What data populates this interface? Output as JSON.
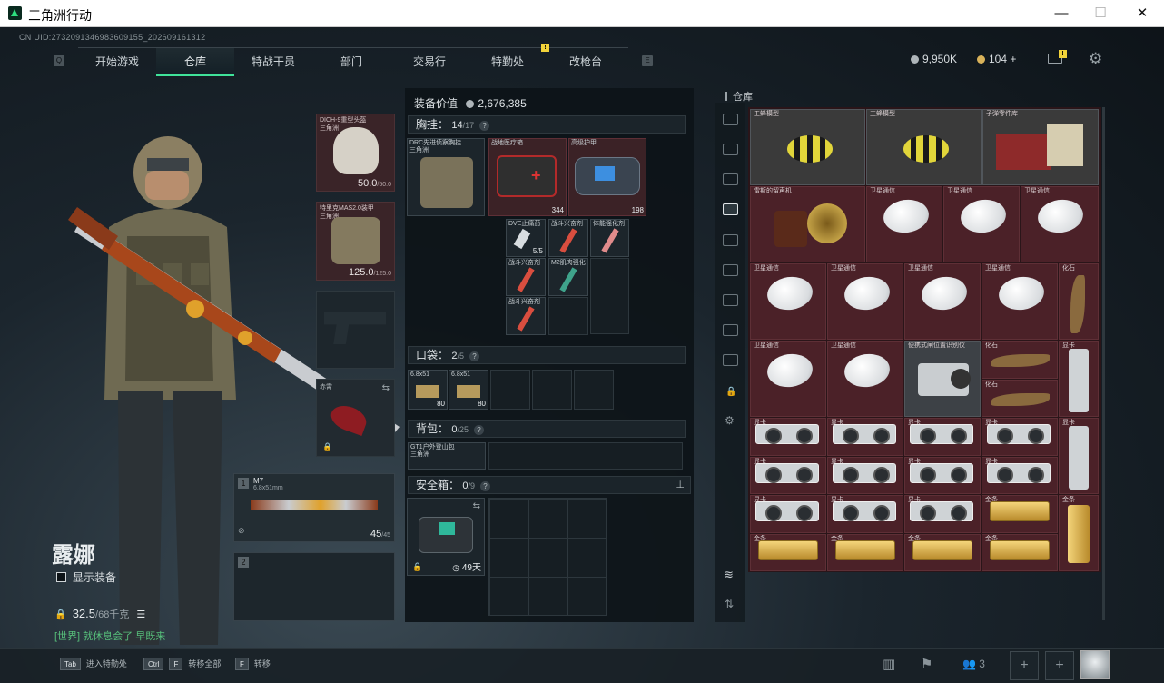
{
  "window": {
    "title": "三角洲行动",
    "minimize": "—",
    "maximize": "☐",
    "close": "✕"
  },
  "uid": "CN UID:2732091346983609155_202609161312",
  "nav": {
    "left_key": "Q",
    "right_key": "E",
    "tabs": [
      "开始游戏",
      "仓库",
      "特战干员",
      "部门",
      "交易行",
      "特勤处",
      "改枪台"
    ],
    "active": "仓库",
    "badge": "!"
  },
  "currency": {
    "money": "9,950K",
    "coins": "104",
    "add": "+",
    "mail_badge": "!"
  },
  "character": {
    "name": "露娜",
    "show_equipment": "显示装备",
    "weight": "32.5",
    "weight_max": "/68千克",
    "world_chat": "[世界] 就休息会了 早既来"
  },
  "gear": {
    "helmet": {
      "name": "DICH-9重型头盔\n三角洲",
      "durability": "50.0",
      "durability_max": "/50.0"
    },
    "armor": {
      "name": "特里克MAS2.0装甲\n三角洲",
      "durability": "125.0",
      "durability_max": "/125.0"
    },
    "melee": {
      "name": "赤霄"
    },
    "primary": {
      "name": "M7",
      "caliber": "6.8x51mm",
      "ammo": "45",
      "ammo_max": "/45"
    },
    "slot1": "1",
    "slot2": "2"
  },
  "equipment_value": {
    "label": "装备价值",
    "value": "2,676,385"
  },
  "chest": {
    "label": "胸挂：",
    "count": "14",
    "max": "/17",
    "items": [
      {
        "name": "DRC先进侦察胸挂\n三角洲",
        "count": ""
      },
      {
        "name": "战地医疗箱",
        "count": "344"
      },
      {
        "name": "高级护甲",
        "count": "198"
      },
      {
        "name": "DVE止痛药",
        "count": "5/5"
      },
      {
        "name": "战斗兴奋剂",
        "count": ""
      },
      {
        "name": "体能强化剂",
        "count": ""
      },
      {
        "name": "战斗兴奋剂",
        "count": ""
      },
      {
        "name": "M2肌肉强化",
        "count": ""
      },
      {
        "name": "战斗兴奋剂",
        "count": ""
      }
    ]
  },
  "pocket": {
    "label": "口袋：",
    "count": "2",
    "max": "/5",
    "items": [
      {
        "name": "6.8x51",
        "count": "80"
      },
      {
        "name": "6.8x51",
        "count": "80"
      }
    ]
  },
  "backpack": {
    "label": "背包：",
    "count": "0",
    "max": "/25",
    "item": "GT1户外登山包\n三角洲"
  },
  "safebox": {
    "label": "安全箱：",
    "count": "0",
    "max": "/9",
    "days": "49天",
    "pin": "⊥"
  },
  "warehouse": {
    "title": "仓库",
    "items": {
      "engineer1": "工蜂模型",
      "engineer2": "工蜂模型",
      "bullet_parts": "子弹零件库",
      "gramophone": "雷斯的留声机",
      "satellite": "卫星通信",
      "fossil": "化石",
      "camera": "便携式闸位置识别仪",
      "gpu": "显卡",
      "gold": "金条"
    }
  },
  "bottom": {
    "hints": [
      {
        "key": "Tab",
        "label": "进入特勤处"
      },
      {
        "key": "Ctrl",
        "key2": "F",
        "label": "转移全部"
      },
      {
        "key": "F",
        "label": "转移"
      }
    ],
    "team_count": "3",
    "add": "+"
  },
  "colors": {
    "accent": "#40e39a",
    "item_bg": "#4b2128",
    "gold_badge": "#f2d33a"
  }
}
